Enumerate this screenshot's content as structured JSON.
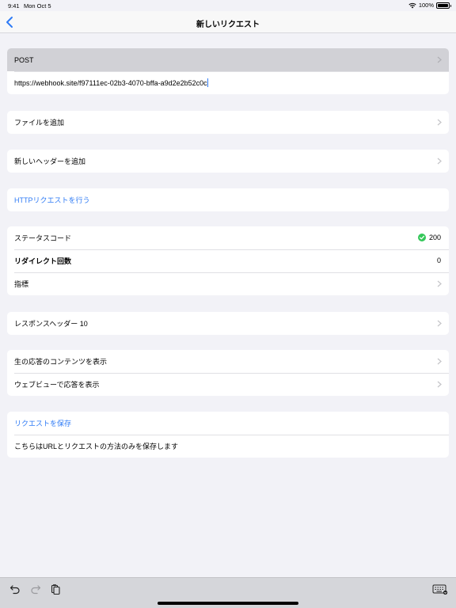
{
  "status": {
    "time": "9:41",
    "date": "Mon Oct 5",
    "battery": "100%"
  },
  "nav": {
    "title": "新しいリクエスト"
  },
  "request": {
    "method": "POST",
    "url": "https://webhook.site/f97111ec-02b3-4070-bffa-a9d2e2b52c0c"
  },
  "actions": {
    "add_file": "ファイルを追加",
    "add_header": "新しいヘッダーを追加",
    "make_request": "HTTPリクエストを行う"
  },
  "result": {
    "status_code_label": "ステータスコード",
    "status_code_value": "200",
    "redirect_label": "リダイレクト回数",
    "redirect_value": "0",
    "metrics_label": "指標"
  },
  "response": {
    "headers_label": "レスポンスヘッダー 10"
  },
  "view": {
    "raw_content": "生の応答のコンテンツを表示",
    "webview": "ウェブビューで応答を表示"
  },
  "save": {
    "save_label": "リクエストを保存",
    "save_note": "こちらはURLとリクエストの方法のみを保存します"
  },
  "colors": {
    "accent": "#2f7bf5",
    "success": "#34c759"
  }
}
